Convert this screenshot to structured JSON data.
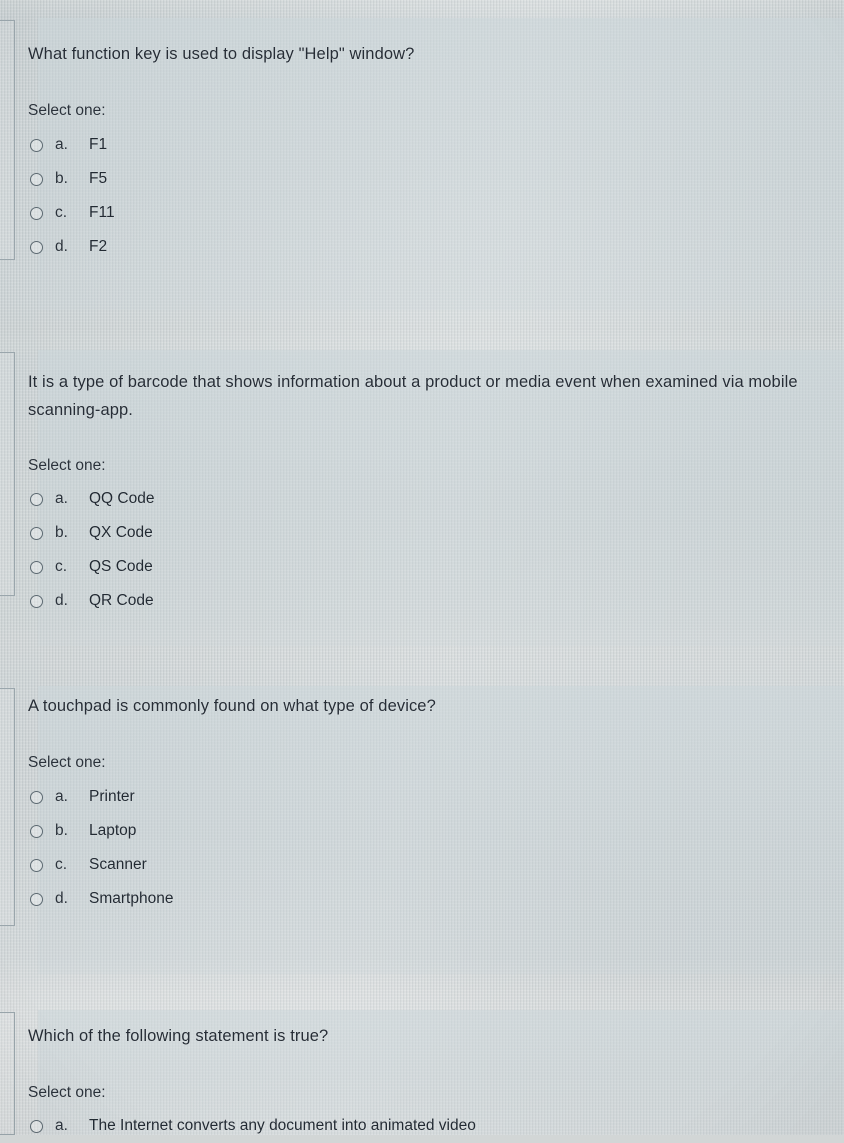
{
  "page": {
    "kind": "quiz-attempt",
    "select_one_label": "Select one:",
    "colors": {
      "screen_background": "#ccd3d5",
      "card_background": "#cbd6da",
      "text": "#262d36",
      "radio_border": "#5d6a72",
      "rail_border": "#9aa6ac"
    }
  },
  "questions": [
    {
      "id": "q1",
      "prompt": "What function key is used to display \"Help\" window?",
      "select_one_label": "Select one:",
      "options": [
        {
          "letter": "a.",
          "label": "F1",
          "selected": false
        },
        {
          "letter": "b.",
          "label": "F5",
          "selected": false
        },
        {
          "letter": "c.",
          "label": "F11",
          "selected": false
        },
        {
          "letter": "d.",
          "label": "F2",
          "selected": false
        }
      ]
    },
    {
      "id": "q2",
      "prompt": "It is a type of barcode that shows information about a product or media event when examined via mobile scanning-app.",
      "select_one_label": "Select one:",
      "options": [
        {
          "letter": "a.",
          "label": "QQ Code",
          "selected": false
        },
        {
          "letter": "b.",
          "label": "QX Code",
          "selected": false
        },
        {
          "letter": "c.",
          "label": "QS Code",
          "selected": false
        },
        {
          "letter": "d.",
          "label": "QR Code",
          "selected": false
        }
      ]
    },
    {
      "id": "q3",
      "prompt": "A touchpad is commonly found on what type of device?",
      "select_one_label": "Select one:",
      "options": [
        {
          "letter": "a.",
          "label": "Printer",
          "selected": false
        },
        {
          "letter": "b.",
          "label": "Laptop",
          "selected": false
        },
        {
          "letter": "c.",
          "label": "Scanner",
          "selected": false
        },
        {
          "letter": "d.",
          "label": "Smartphone",
          "selected": false
        }
      ]
    },
    {
      "id": "q4",
      "prompt": "Which of the following statement is true?",
      "select_one_label": "Select one:",
      "options": [
        {
          "letter": "a.",
          "label": "The Internet converts any document into animated video",
          "selected": false
        }
      ]
    }
  ]
}
